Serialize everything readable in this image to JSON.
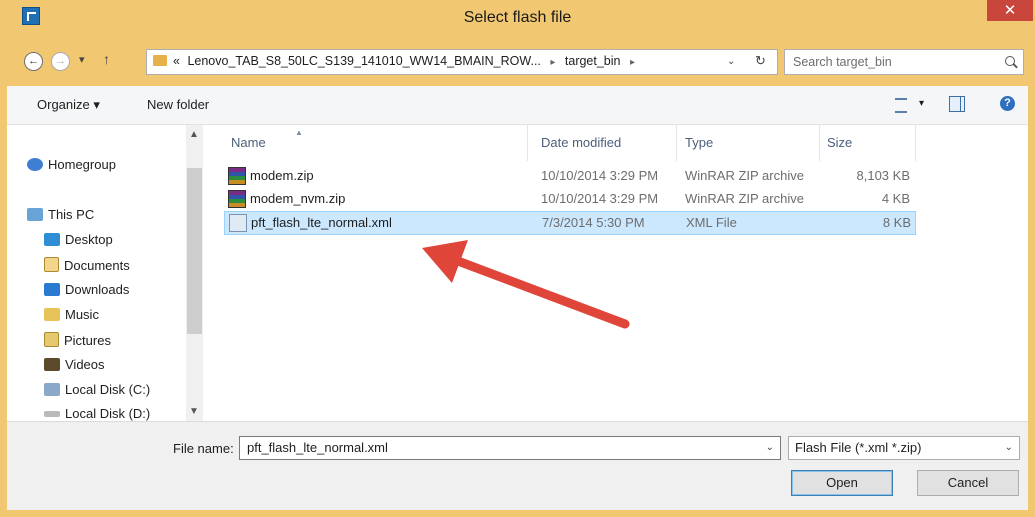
{
  "window": {
    "title": "Select flash file",
    "close_glyph": "✕",
    "colors": {
      "frame": "#F1C871",
      "close": "#C9463D",
      "selection": "#CCE8FF",
      "arrow": "#E0453A"
    }
  },
  "address": {
    "back_glyph": "←",
    "forward_glyph": "→",
    "recent_glyph": "▾",
    "up_glyph": "↑",
    "crumbs_prefix": "«",
    "crumb1": "Lenovo_TAB_S8_50LC_S139_141010_WW14_BMAIN_ROW...",
    "crumb2": "target_bin",
    "sep_glyph": "▸",
    "dropdown_glyph": "⌄",
    "refresh_glyph": "↻",
    "search_placeholder": "Search target_bin"
  },
  "toolbar": {
    "organize_label": "Organize ▾",
    "new_folder_label": "New folder",
    "views_drop": "▾",
    "help_glyph": "?"
  },
  "nav": {
    "scroll_up": "▲",
    "scroll_down": "▼",
    "items": [
      {
        "label": "Homegroup"
      },
      {
        "label": "This PC"
      },
      {
        "label": "Desktop"
      },
      {
        "label": "Documents"
      },
      {
        "label": "Downloads"
      },
      {
        "label": "Music"
      },
      {
        "label": "Pictures"
      },
      {
        "label": "Videos"
      },
      {
        "label": "Local Disk (C:)"
      },
      {
        "label": "Local Disk (D:)"
      }
    ]
  },
  "files": {
    "sort_glyph": "▲",
    "columns": {
      "name": "Name",
      "date": "Date modified",
      "type": "Type",
      "size": "Size"
    },
    "rows": [
      {
        "name": "modem.zip",
        "date": "10/10/2014 3:29 PM",
        "type": "WinRAR ZIP archive",
        "size": "8,103 KB",
        "icon": "winrar-icon"
      },
      {
        "name": "modem_nvm.zip",
        "date": "10/10/2014 3:29 PM",
        "type": "WinRAR ZIP archive",
        "size": "4 KB",
        "icon": "winrar-icon"
      },
      {
        "name": "pft_flash_lte_normal.xml",
        "date": "7/3/2014 5:30 PM",
        "type": "XML File",
        "size": "8 KB",
        "icon": "xml-file-icon",
        "selected": true
      }
    ]
  },
  "bottom": {
    "file_name_label": "File name:",
    "file_name_value": "pft_flash_lte_normal.xml",
    "filter_value": "Flash File (*.xml *.zip)",
    "dropdown_glyph": "⌄",
    "open_label": "Open",
    "cancel_label": "Cancel"
  }
}
